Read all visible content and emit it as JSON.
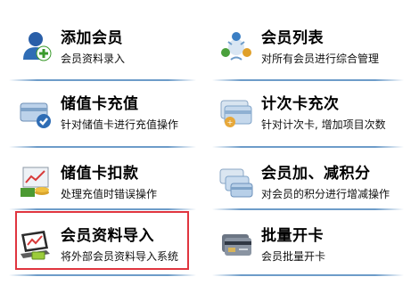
{
  "tiles": [
    {
      "title": "添加会员",
      "desc": "会员资料录入",
      "icon": "add-member-icon"
    },
    {
      "title": "会员列表",
      "desc": "对所有会员进行综合管理",
      "icon": "member-list-icon"
    },
    {
      "title": "储值卡充值",
      "desc": "针对储值卡进行充值操作",
      "icon": "card-recharge-icon"
    },
    {
      "title": "计次卡充次",
      "desc": "针对计次卡, 增加项目次数",
      "icon": "count-card-icon"
    },
    {
      "title": "储值卡扣款",
      "desc": "处理充值时错误操作",
      "icon": "card-deduct-icon"
    },
    {
      "title": "会员加、减积分",
      "desc": "对会员的积分进行增减操作",
      "icon": "points-adjust-icon"
    },
    {
      "title": "会员资料导入",
      "desc": "将外部会员资料导入系统",
      "icon": "import-data-icon"
    },
    {
      "title": "批量开卡",
      "desc": "会员批量开卡",
      "icon": "batch-card-icon"
    }
  ],
  "colors": {
    "highlight": "#e0353f",
    "separator": "#6d9cc9"
  }
}
